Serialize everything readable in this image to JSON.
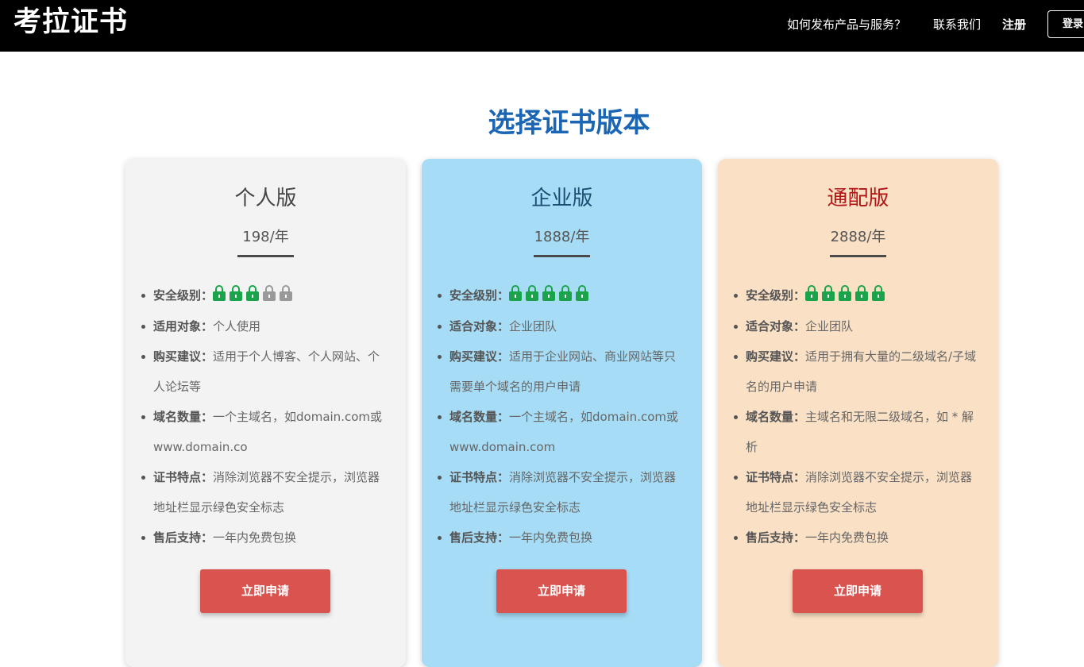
{
  "header": {
    "logo_text": "考拉证书",
    "nav": {
      "how_to_publish": "如何发布产品与服务？",
      "contact_us": "联系我们",
      "register": "注册",
      "login": "登录"
    }
  },
  "main": {
    "title": "选择证书版本",
    "security_levels": {
      "personal": 3,
      "enterprise": 5,
      "wildcard": 5
    },
    "colors": {
      "title": "#1a66b5",
      "lock_on": "#1aa34a",
      "lock_off": "#999999",
      "apply_button": "#d9534f",
      "personal_card_bg": "#f3f3f3",
      "enterprise_card_bg": "#a6dcf5",
      "wildcard_card_bg": "#fae0c5"
    },
    "plans": [
      {
        "title": "个人版",
        "price": "198/年",
        "security_label": "安全级别：",
        "target_label": "适用对象：",
        "target_value": "个人使用",
        "advice_label": "购买建议：",
        "advice_value": "适用于个人博客、个人网站、个人论坛等",
        "domains_label": "域名数量：",
        "domains_value": "一个主域名，如domain.com或www.domain.co",
        "features_label": "证书特点：",
        "features_value": "消除浏览器不安全提示，浏览器地址栏显示绿色安全标志",
        "support_label": "售后支持：",
        "support_value": "一年内免费包换",
        "button": "立即申请"
      },
      {
        "title": "企业版",
        "price": "1888/年",
        "security_label": "安全级别：",
        "target_label": "适合对象：",
        "target_value": "企业团队",
        "advice_label": "购买建议：",
        "advice_value": "适用于企业网站、商业网站等只需要单个域名的用户申请",
        "domains_label": "域名数量：",
        "domains_value": "一个主域名，如domain.com或www.domain.com",
        "features_label": "证书特点：",
        "features_value": "消除浏览器不安全提示，浏览器地址栏显示绿色安全标志",
        "support_label": "售后支持：",
        "support_value": "一年内免费包换",
        "button": "立即申请"
      },
      {
        "title": "通配版",
        "price": "2888/年",
        "security_label": "安全级别：",
        "target_label": "适合对象：",
        "target_value": "企业团队",
        "advice_label": "购买建议：",
        "advice_value": "适用于拥有大量的二级域名/子域名的用户申请",
        "domains_label": "域名数量：",
        "domains_value": "主域名和无限二级域名，如 * 解析",
        "features_label": "证书特点：",
        "features_value": "消除浏览器不安全提示，浏览器地址栏显示绿色安全标志",
        "support_label": "售后支持：",
        "support_value": "一年内免费包换",
        "button": "立即申请"
      }
    ]
  }
}
